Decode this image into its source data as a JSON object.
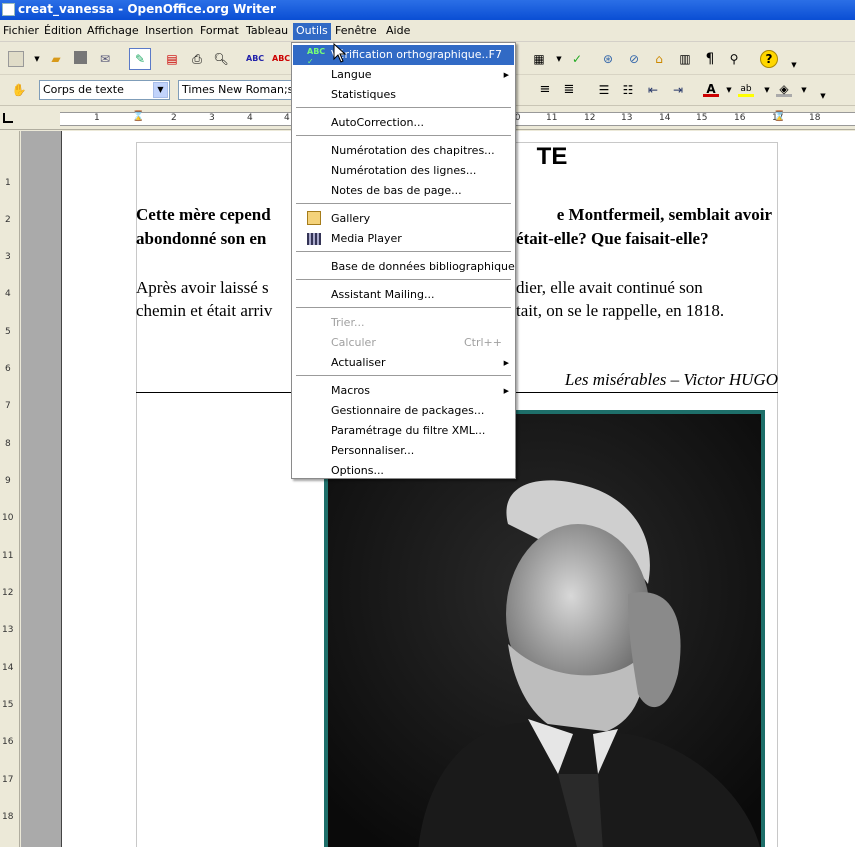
{
  "window": {
    "title": "creat_vanessa - OpenOffice.org Writer"
  },
  "menubar": {
    "items": [
      "Fichier",
      "Édition",
      "Affichage",
      "Insertion",
      "Format",
      "Tableau",
      "Outils",
      "Fenêtre",
      "Aide"
    ],
    "active": "Outils"
  },
  "format_toolbar": {
    "paragraph_style": "Corps de texte",
    "font_name": "Times New Roman;seri"
  },
  "ruler": {
    "horizontal": [
      "1",
      "2",
      "3",
      "4",
      "10",
      "11",
      "12",
      "13",
      "14",
      "15",
      "16",
      "17",
      "18"
    ],
    "vertical": [
      "1",
      "2",
      "3",
      "4",
      "5",
      "6",
      "7",
      "8",
      "9",
      "10",
      "11",
      "12",
      "13",
      "14",
      "15",
      "16",
      "17",
      "18"
    ]
  },
  "document": {
    "heading_visible": "TE",
    "para1_line1_left": "Cette mère cepend",
    "para1_line1_right": "e Montfermeil, semblait avoir",
    "para1_line2_left": "abondonné son en",
    "para1_line2_right": "était-elle? Que faisait-elle?",
    "para2_line1_left": "Après avoir laissé s",
    "para2_line1_right": "dier, elle avait continué son",
    "para2_line2_left": "chemin et était arriv",
    "para2_line2_right": "tait, on se le rappelle, en 1818.",
    "quote": "Les misérables – Victor HUGO"
  },
  "tools_menu": {
    "spellcheck": {
      "label": "Vérification orthographique...",
      "shortcut": "F7",
      "highlighted": true
    },
    "langue": {
      "label": "Langue"
    },
    "statistiques": {
      "label": "Statistiques"
    },
    "autocorrection": {
      "label": "AutoCorrection..."
    },
    "numerotation_chapitres": {
      "label": "Numérotation des chapitres..."
    },
    "numerotation_lignes": {
      "label": "Numérotation des lignes..."
    },
    "notes": {
      "label": "Notes de bas de page..."
    },
    "gallery": {
      "label": "Gallery"
    },
    "media_player": {
      "label": "Media Player"
    },
    "biblio": {
      "label": "Base de données bibliographique"
    },
    "mailing": {
      "label": "Assistant Mailing..."
    },
    "trier": {
      "label": "Trier...",
      "disabled": true
    },
    "calculer": {
      "label": "Calculer",
      "shortcut": "Ctrl++",
      "disabled": true
    },
    "actualiser": {
      "label": "Actualiser"
    },
    "macros": {
      "label": "Macros"
    },
    "packages": {
      "label": "Gestionnaire de packages..."
    },
    "xml_filter": {
      "label": "Paramétrage du filtre XML..."
    },
    "personnaliser": {
      "label": "Personnaliser..."
    },
    "options": {
      "label": "Options..."
    }
  },
  "colors": {
    "titlebar": "#0a4ed4",
    "highlight": "#316ac5",
    "photo_border": "#1e6f6a"
  }
}
